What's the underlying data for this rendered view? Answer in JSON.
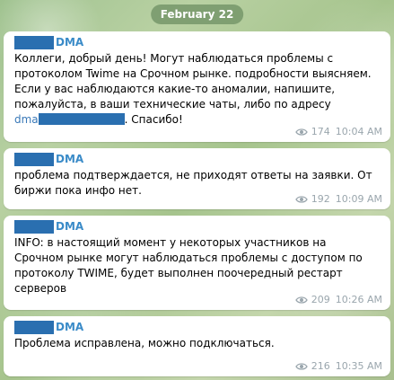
{
  "date_label": "February 22",
  "sender": {
    "name_suffix": "DMA"
  },
  "messages": [
    {
      "lines": [
        "Коллеги, добрый день! Могут наблюдаться проблемы с",
        "протоколом Twime на Срочном рынке. подробности выясняем.",
        "Если у вас наблюдаются какие-то аномалии, напишите,",
        "пожалуйста, в ваши технические чаты, либо по адресу"
      ],
      "link_prefix": "dma",
      "after_link": ". Спасибо!",
      "views": "174",
      "time": "10:04 AM"
    },
    {
      "lines": [
        "проблема подтверждается, не приходят ответы на заявки.  От",
        "биржи пока инфо нет."
      ],
      "views": "192",
      "time": "10:09 AM"
    },
    {
      "lines": [
        "INFO: в настоящий момент у некоторых участников на",
        "Срочном рынке могут наблюдаться проблемы с доступом по",
        "протоколу TWIME, будет выполнен поочередный рестарт",
        "серверов"
      ],
      "views": "209",
      "time": "10:26 AM"
    },
    {
      "lines": [
        "Проблема исправлена, можно подключаться."
      ],
      "views": "216",
      "time": "10:35 AM"
    }
  ]
}
